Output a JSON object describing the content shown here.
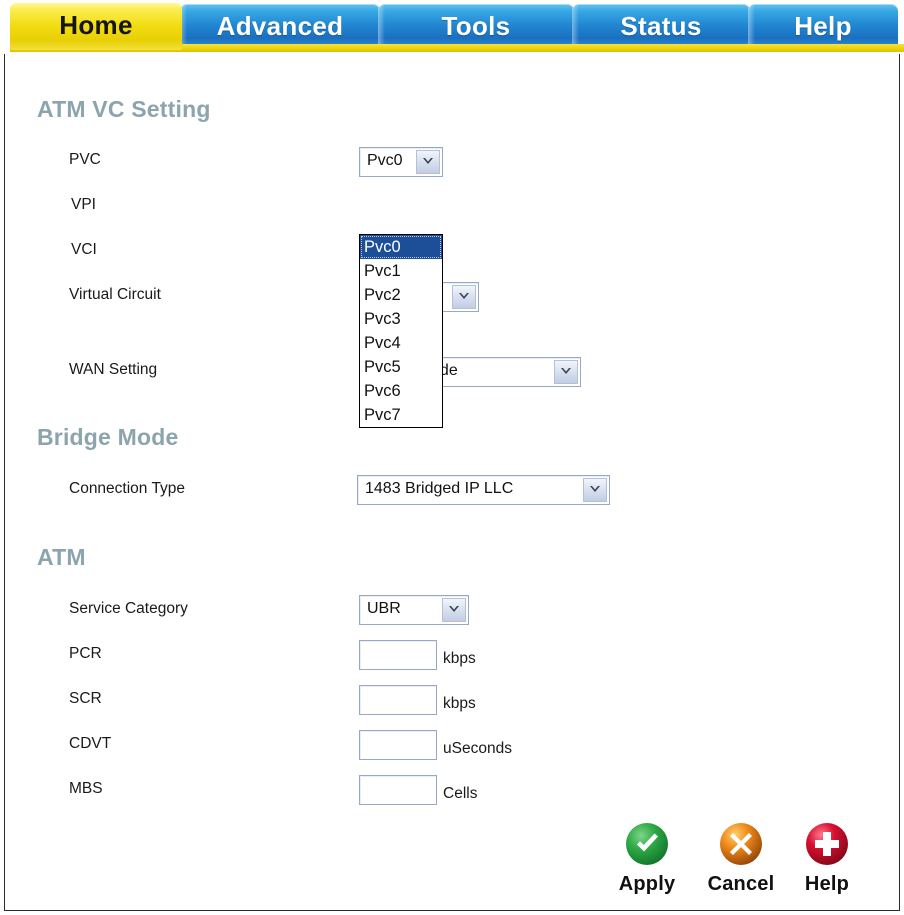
{
  "nav": {
    "tabs": [
      {
        "id": "home",
        "label": "Home",
        "active": true
      },
      {
        "id": "advanced",
        "label": "Advanced",
        "active": false
      },
      {
        "id": "tools",
        "label": "Tools",
        "active": false
      },
      {
        "id": "status",
        "label": "Status",
        "active": false
      },
      {
        "id": "help",
        "label": "Help",
        "active": false
      }
    ],
    "active_color": "#f2dd12",
    "inactive_color": "#2288d2"
  },
  "sections": {
    "atm_vc_setting": {
      "heading": "ATM VC Setting",
      "fields": {
        "pvc_label": "PVC",
        "vpi_label": "VPI",
        "vci_label": "VCI",
        "virtual_circuit_label": "Virtual Circuit",
        "wan_setting_label": "WAN Setting"
      },
      "pvc_select": {
        "value": "Pvc0",
        "expanded": true,
        "options": [
          "Pvc0",
          "Pvc1",
          "Pvc2",
          "Pvc3",
          "Pvc4",
          "Pvc5",
          "Pvc6",
          "Pvc7"
        ],
        "selected_index": 0
      },
      "vpi_value": "",
      "vci_value": "",
      "virtual_circuit_select": {
        "value": ""
      },
      "wan_setting_select": {
        "value": "Bridge Mode"
      }
    },
    "bridge_mode": {
      "heading": "Bridge Mode",
      "connection_type_label": "Connection Type",
      "connection_type_select": {
        "value": "1483 Bridged IP LLC"
      }
    },
    "atm": {
      "heading": "ATM",
      "service_category_label": "Service Category",
      "service_category_select": {
        "value": "UBR"
      },
      "rows": [
        {
          "label": "PCR",
          "value": "",
          "unit": "kbps"
        },
        {
          "label": "SCR",
          "value": "",
          "unit": "kbps"
        },
        {
          "label": "CDVT",
          "value": "",
          "unit": "uSeconds"
        },
        {
          "label": "MBS",
          "value": "",
          "unit": "Cells"
        }
      ]
    }
  },
  "actions": [
    {
      "id": "apply",
      "label": "Apply",
      "icon": "check-circle-icon",
      "color": "#1f9c3a"
    },
    {
      "id": "cancel",
      "label": "Cancel",
      "icon": "x-circle-icon",
      "color": "#e8862a"
    },
    {
      "id": "help",
      "label": "Help",
      "icon": "plus-circle-icon",
      "color": "#cf1030"
    }
  ],
  "heading_color": "#8ba4ad"
}
